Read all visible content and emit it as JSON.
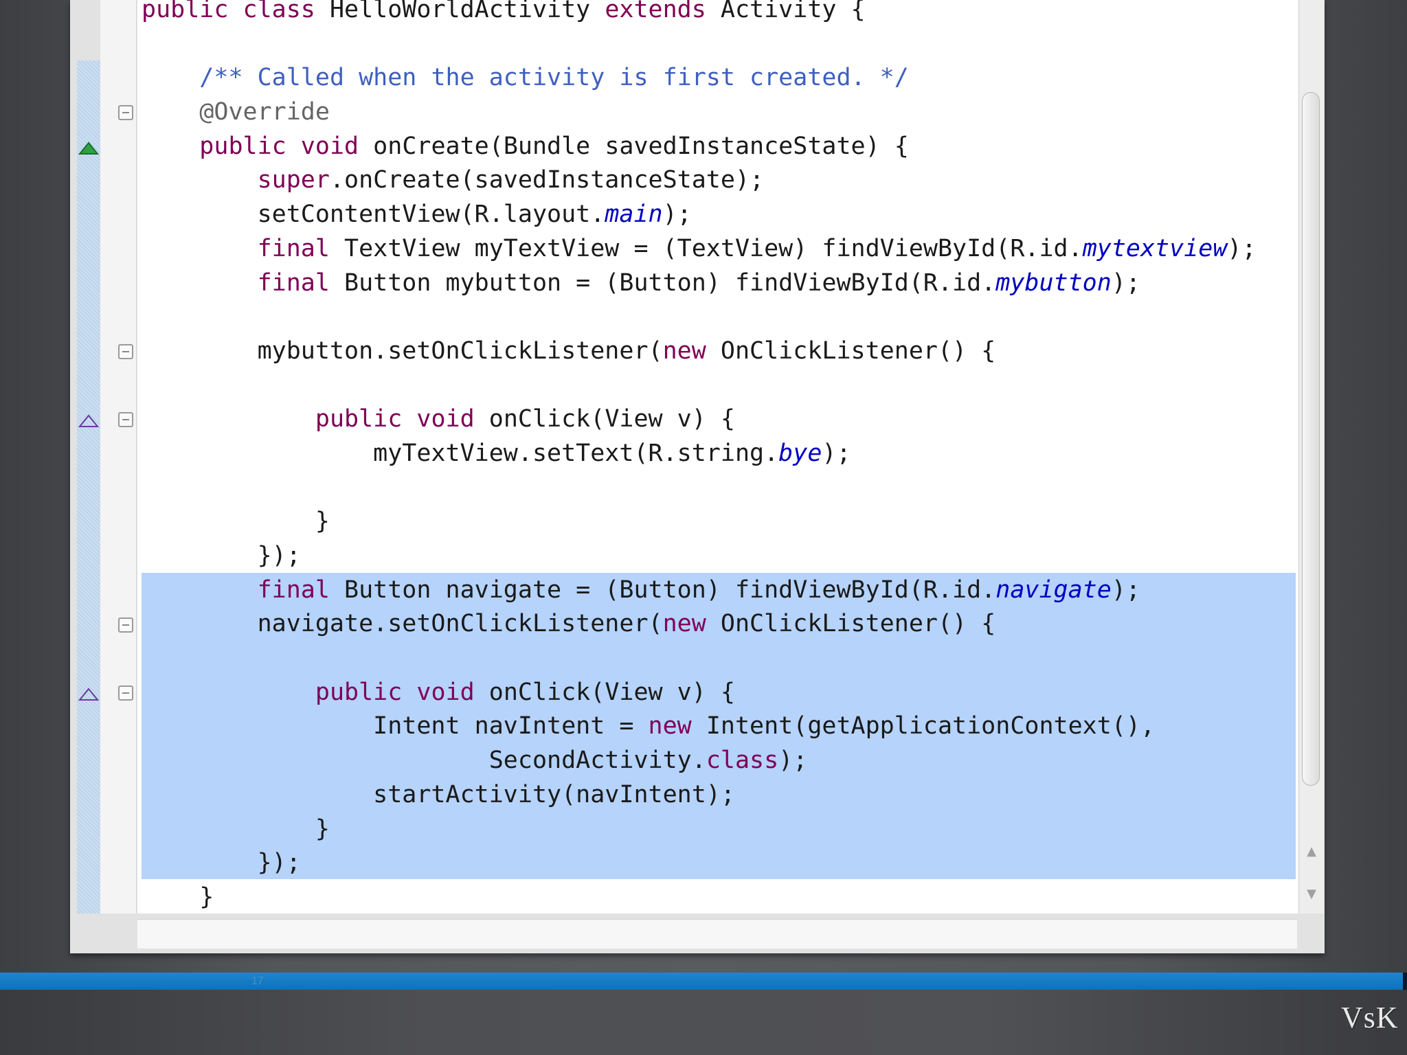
{
  "code_lines": [
    [
      {
        "t": "public class ",
        "c": "kw"
      },
      {
        "t": "HelloWorldActivity "
      },
      {
        "t": "extends ",
        "c": "kw"
      },
      {
        "t": "Activity {"
      }
    ],
    [],
    [
      {
        "t": "    "
      },
      {
        "t": "/** Called when the activity is first created. */",
        "c": "cm"
      }
    ],
    [
      {
        "t": "    "
      },
      {
        "t": "@Override",
        "c": "an"
      }
    ],
    [
      {
        "t": "    "
      },
      {
        "t": "public void ",
        "c": "kw"
      },
      {
        "t": "onCreate(Bundle savedInstanceState) {"
      }
    ],
    [
      {
        "t": "        "
      },
      {
        "t": "super",
        "c": "kw"
      },
      {
        "t": ".onCreate(savedInstanceState);"
      }
    ],
    [
      {
        "t": "        setContentView(R.layout."
      },
      {
        "t": "main",
        "c": "fld"
      },
      {
        "t": ");"
      }
    ],
    [
      {
        "t": "        "
      },
      {
        "t": "final ",
        "c": "kw"
      },
      {
        "t": "TextView myTextView = (TextView) findViewById(R.id."
      },
      {
        "t": "mytextview",
        "c": "fld"
      },
      {
        "t": ");"
      }
    ],
    [
      {
        "t": "        "
      },
      {
        "t": "final ",
        "c": "kw"
      },
      {
        "t": "Button mybutton = (Button) findViewById(R.id."
      },
      {
        "t": "mybutton",
        "c": "fld"
      },
      {
        "t": ");"
      }
    ],
    [],
    [
      {
        "t": "        mybutton.setOnClickListener("
      },
      {
        "t": "new ",
        "c": "kw"
      },
      {
        "t": "OnClickListener() {"
      }
    ],
    [],
    [
      {
        "t": "            "
      },
      {
        "t": "public void ",
        "c": "kw"
      },
      {
        "t": "onClick(View v) {"
      }
    ],
    [
      {
        "t": "                myTextView.setText(R.string."
      },
      {
        "t": "bye",
        "c": "fld"
      },
      {
        "t": ");"
      }
    ],
    [],
    [
      {
        "t": "            }"
      }
    ],
    [
      {
        "t": "        });"
      }
    ],
    [
      {
        "t": "        "
      },
      {
        "t": "final ",
        "c": "kw"
      },
      {
        "t": "Button navigate = (Button) findViewById(R.id."
      },
      {
        "t": "navigate",
        "c": "fld"
      },
      {
        "t": ");"
      }
    ],
    [
      {
        "t": "        navigate.setOnClickListener("
      },
      {
        "t": "new ",
        "c": "kw"
      },
      {
        "t": "OnClickListener() {"
      }
    ],
    [],
    [
      {
        "t": "            "
      },
      {
        "t": "public void ",
        "c": "kw"
      },
      {
        "t": "onClick(View v) {"
      }
    ],
    [
      {
        "t": "                Intent navIntent = "
      },
      {
        "t": "new ",
        "c": "kw"
      },
      {
        "t": "Intent(getApplicationContext(),"
      }
    ],
    [
      {
        "t": "                        SecondActivity."
      },
      {
        "t": "class",
        "c": "kw"
      },
      {
        "t": ");"
      }
    ],
    [
      {
        "t": "                startActivity(navIntent);"
      }
    ],
    [
      {
        "t": "            }"
      }
    ],
    [
      {
        "t": "        });"
      }
    ],
    [
      {
        "t": "    }"
      }
    ]
  ],
  "fold_marker_lines": [
    3,
    10,
    12,
    18,
    20
  ],
  "override_marker_lines": [
    {
      "line": 4,
      "kind": "implements-filled"
    },
    {
      "line": 12,
      "kind": "overrides-outline"
    },
    {
      "line": 20,
      "kind": "overrides-outline"
    }
  ],
  "selection": {
    "first_line": 17,
    "last_line": 25
  },
  "scrollbar": {
    "up_arrow": "▲",
    "down_arrow": "▼"
  },
  "footer": {
    "slide_number": "17",
    "author_mark": "VsK"
  },
  "colors": {
    "keyword": "#7f0055",
    "comment": "#3f5fbf",
    "annotation": "#646464",
    "field": "#0000c0",
    "selection": "#b5d3fb",
    "footer_bar": "#1478c4"
  }
}
